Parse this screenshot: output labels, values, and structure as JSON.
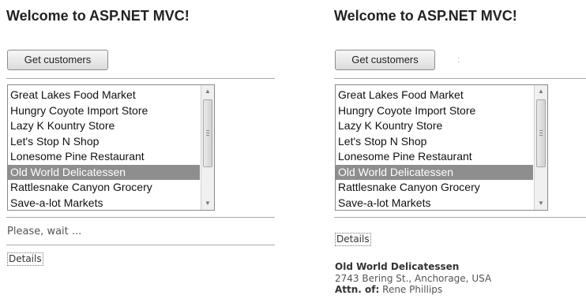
{
  "left": {
    "title": "Welcome to ASP.NET MVC!",
    "get_customers_label": "Get customers",
    "customers": [
      "Great Lakes Food Market",
      "Hungry Coyote Import Store",
      "Lazy K Kountry Store",
      "Let's Stop N Shop",
      "Lonesome Pine Restaurant",
      "Old World Delicatessen",
      "Rattlesnake Canyon Grocery",
      "Save-a-lot Markets"
    ],
    "selected_customer": "Old World Delicatessen",
    "wait_message": "Please, wait ...",
    "details_label": "Details"
  },
  "right": {
    "title": "Welcome to ASP.NET MVC!",
    "get_customers_label": "Get customers",
    "customers": [
      "Great Lakes Food Market",
      "Hungry Coyote Import Store",
      "Lazy K Kountry Store",
      "Let's Stop N Shop",
      "Lonesome Pine Restaurant",
      "Old World Delicatessen",
      "Rattlesnake Canyon Grocery",
      "Save-a-lot Markets"
    ],
    "selected_customer": "Old World Delicatessen",
    "details_label": "Details",
    "details": {
      "company": "Old World Delicatessen",
      "address": "2743 Bering St., Anchorage, USA",
      "attn_label": "Attn. of:",
      "contact": "Rene Phillips"
    }
  },
  "icons": {
    "scroll_up": "scroll-up-arrow-icon",
    "scroll_down": "scroll-down-arrow-icon"
  }
}
